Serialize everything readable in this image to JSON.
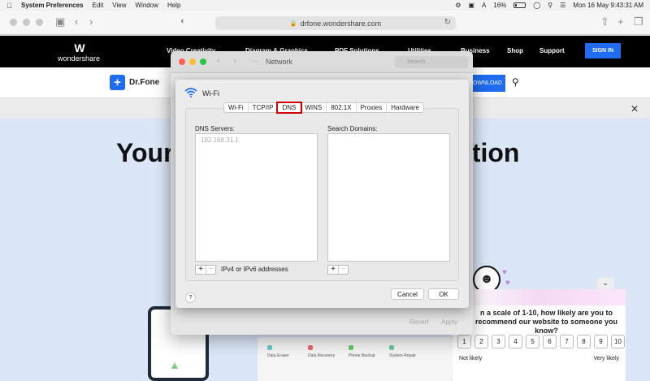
{
  "menubar": {
    "app_name": "System Preferences",
    "items": [
      "Edit",
      "View",
      "Window",
      "Help"
    ],
    "battery": "16%",
    "clock": "Mon 16 May  9:43:31 AM"
  },
  "browser": {
    "url": "drfone.wondershare.com"
  },
  "site": {
    "brand": "wondershare",
    "nav": [
      "Video Creativity",
      "Diagram & Graphics",
      "PDF Solutions",
      "Utilities",
      "Business",
      "Shop",
      "Support"
    ],
    "signin": "SIGN IN",
    "product": "Dr.Fone",
    "download": "DOWNLOAD",
    "hero_left": "Your",
    "hero_right": "ation",
    "apps": [
      "Data Eraser",
      "Data Recovery",
      "Phone Backup",
      "System Repair"
    ]
  },
  "survey": {
    "question": "n a scale of 1-10, how likely are you to recommend our website to someone you know?",
    "scale": [
      "1",
      "2",
      "3",
      "4",
      "5",
      "6",
      "7",
      "8",
      "9",
      "10"
    ],
    "low_label": "Not likely",
    "high_label": "Very likely"
  },
  "network_window": {
    "title": "Network",
    "search_placeholder": "Search",
    "revert": "Revert",
    "apply": "Apply"
  },
  "dns_sheet": {
    "interface": "Wi-Fi",
    "tabs": [
      "Wi-Fi",
      "TCP/IP",
      "DNS",
      "WINS",
      "802.1X",
      "Proxies",
      "Hardware"
    ],
    "active_tab": "DNS",
    "dns_servers_label": "DNS Servers:",
    "dns_servers": [
      "192.168.31.1"
    ],
    "search_domains_label": "Search Domains:",
    "plus": "+",
    "minus": "−",
    "address_hint": "IPv4 or IPv6 addresses",
    "help": "?",
    "cancel": "Cancel",
    "ok": "OK"
  },
  "colors": {
    "highlight": "#d20000",
    "accent_blue": "#1f6cf0"
  }
}
